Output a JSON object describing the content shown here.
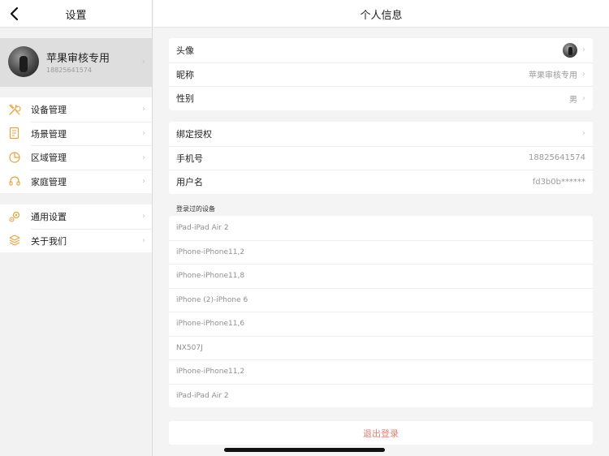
{
  "sidebar": {
    "title": "设置",
    "profile": {
      "name": "苹果审核专用",
      "phone": "18825641574"
    },
    "groups": [
      {
        "items": [
          {
            "label": "设备管理",
            "icon": "tools-icon"
          },
          {
            "label": "场景管理",
            "icon": "document-icon"
          },
          {
            "label": "区域管理",
            "icon": "pie-chart-icon"
          },
          {
            "label": "家庭管理",
            "icon": "headset-icon"
          }
        ]
      },
      {
        "items": [
          {
            "label": "通用设置",
            "icon": "gears-icon"
          },
          {
            "label": "关于我们",
            "icon": "layers-icon"
          }
        ]
      }
    ]
  },
  "main": {
    "title": "个人信息",
    "basic": [
      {
        "label": "头像",
        "value": ""
      },
      {
        "label": "昵称",
        "value": "苹果审核专用"
      },
      {
        "label": "性别",
        "value": "男"
      }
    ],
    "account": [
      {
        "label": "绑定授权",
        "value": ""
      },
      {
        "label": "手机号",
        "value": "18825641574"
      },
      {
        "label": "用户名",
        "value": "fd3b0b******"
      }
    ],
    "devices_title": "登录过的设备",
    "devices": [
      "iPad-iPad Air 2",
      "iPhone-iPhone11,2",
      "iPhone-iPhone11,8",
      "iPhone (2)-iPhone 6",
      "iPhone-iPhone11,6",
      "NX507J",
      "iPhone-iPhone11,2",
      "iPad-iPad Air 2"
    ],
    "logout_label": "退出登录"
  },
  "colors": {
    "accent": "#e8a23a",
    "logout": "#f07a6e"
  }
}
